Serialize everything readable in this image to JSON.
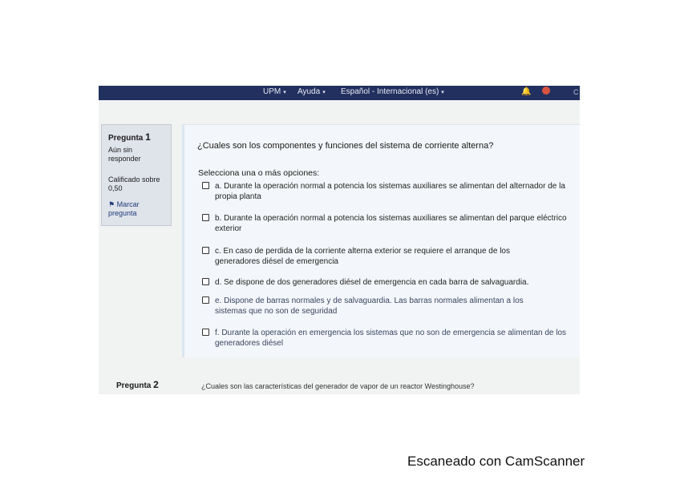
{
  "navbar": {
    "items": [
      {
        "label": "UPM",
        "caret": "▾"
      },
      {
        "label": "Ayuda",
        "caret": "▾"
      },
      {
        "label": "Español - Internacional (es)",
        "caret": "▾"
      }
    ],
    "edge_text": "C"
  },
  "sidebar": {
    "question_label": "Pregunta",
    "question_number": "1",
    "status": "Aún sin responder",
    "grade": "Calificado sobre 0,50",
    "flag_label": "Marcar pregunta"
  },
  "question": {
    "text": "¿Cuales son los componentes y funciones del sistema de corriente alterna?",
    "prompt": "Selecciona una o más opciones:",
    "options": [
      "a. Durante la operación normal a potencia los sistemas auxiliares se alimentan del alternador de la propia planta",
      "b. Durante la operación normal a potencia los sistemas auxiliares se alimentan del parque eléctrico exterior",
      "c. En caso de perdida de la corriente alterna exterior se requiere el arranque de los generadores diésel de emergencia",
      "d. Se dispone de dos generadores diésel de emergencia en cada barra de salvaguardia.",
      "e. Dispone de barras normales y de salvaguardia. Las barras normales alimentan a los sistemas que no son de seguridad",
      "f. Durante la operación en emergencia los sistemas que no son de emergencia se alimentan de los generadores diésel"
    ]
  },
  "next_question": {
    "label": "Pregunta",
    "number": "2",
    "text": "¿Cuales son las características del generador de vapor de un reactor Westinghouse?"
  },
  "footer": {
    "scanner_text": "Escaneado con CamScanner"
  },
  "colors": {
    "navbar": "#22305f",
    "info_block": "#dfe3ea",
    "question_box": "#f3f6fa"
  }
}
